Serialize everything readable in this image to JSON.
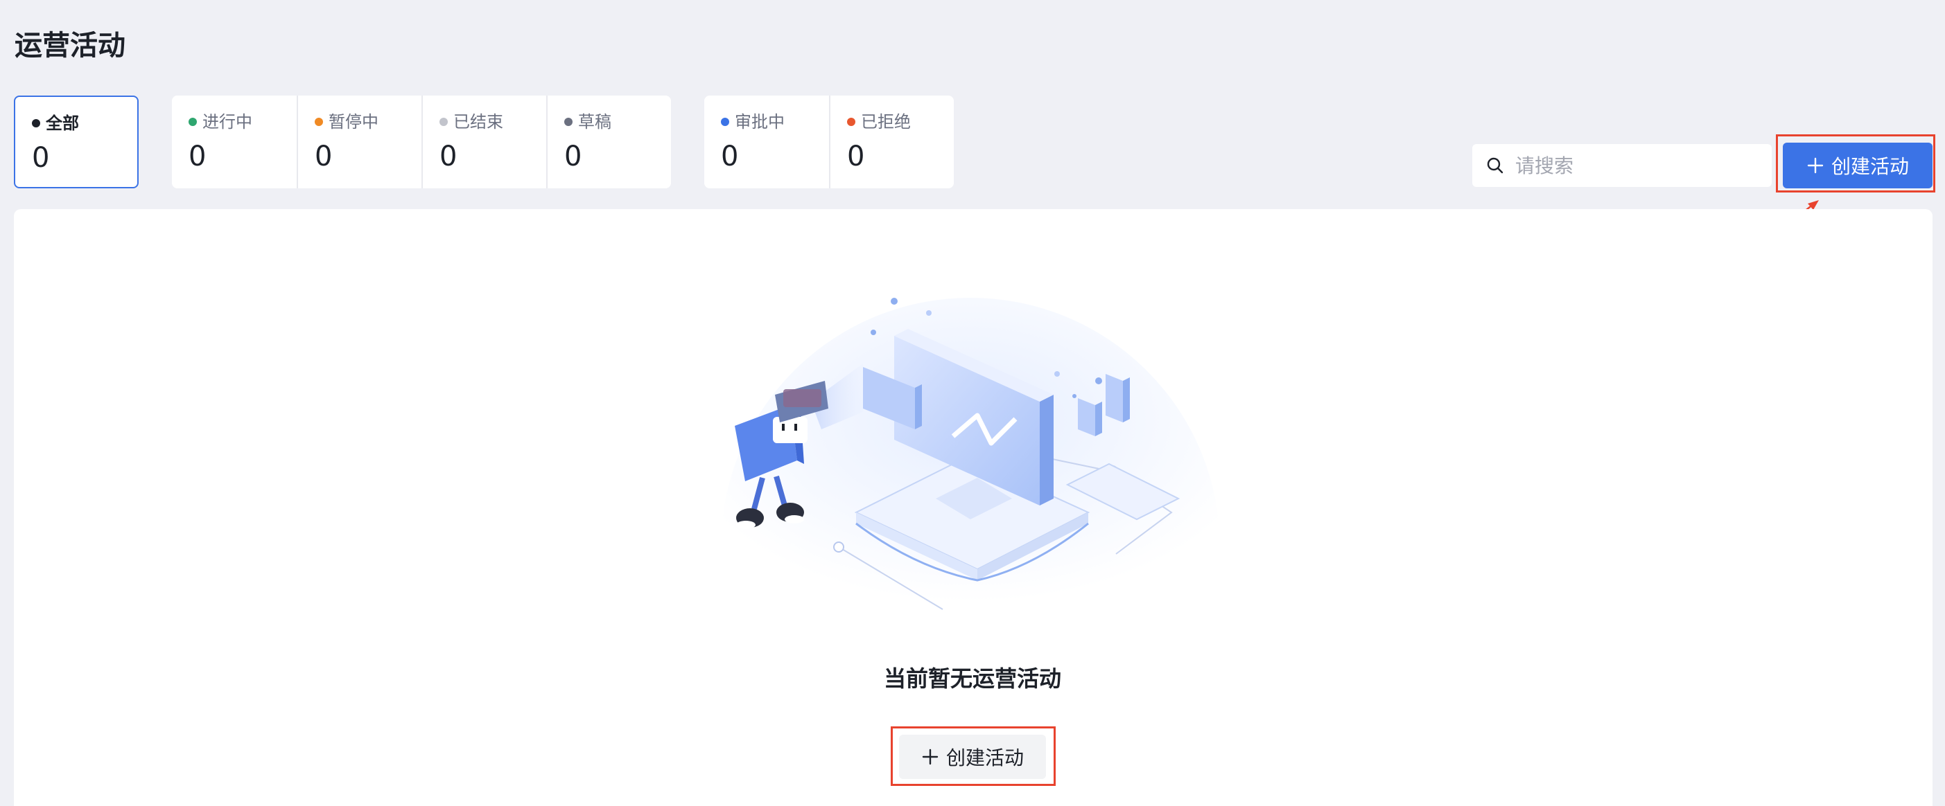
{
  "page": {
    "title": "运营活动"
  },
  "tabs": {
    "group_main": [
      {
        "label": "全部",
        "count": "0",
        "color": "#1d2129"
      }
    ],
    "group_status": [
      {
        "label": "进行中",
        "count": "0",
        "color": "#2ea66f"
      },
      {
        "label": "暂停中",
        "count": "0",
        "color": "#f08a24"
      },
      {
        "label": "已结束",
        "count": "0",
        "color": "#c2c4cc"
      },
      {
        "label": "草稿",
        "count": "0",
        "color": "#6b7080"
      }
    ],
    "group_approval": [
      {
        "label": "审批中",
        "count": "0",
        "color": "#3b73e6"
      },
      {
        "label": "已拒绝",
        "count": "0",
        "color": "#e8572e"
      }
    ]
  },
  "search": {
    "placeholder": "请搜索",
    "value": ""
  },
  "toolbar": {
    "create_label": "创建活动"
  },
  "empty_state": {
    "message": "当前暂无运营活动",
    "create_label": "创建活动"
  },
  "colors": {
    "primary": "#3b73e6",
    "annotation": "#e8432e",
    "background": "#eff0f5"
  },
  "icons": {
    "search": "search-icon",
    "plus": "plus-icon",
    "illustration": "empty-illustration"
  }
}
